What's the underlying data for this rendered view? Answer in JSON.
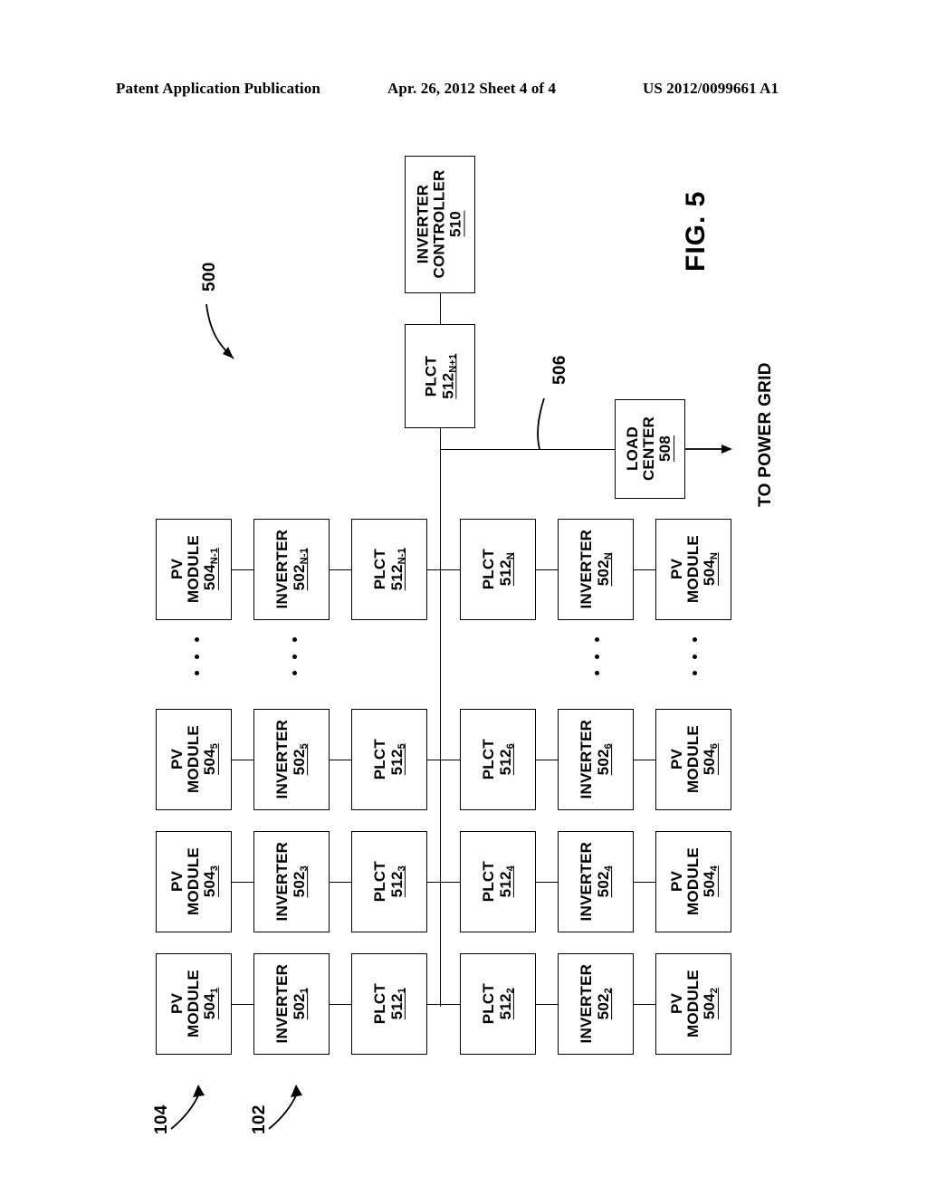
{
  "header": {
    "left": "Patent Application Publication",
    "middle": "Apr. 26, 2012  Sheet 4 of 4",
    "right": "US 2012/0099661 A1"
  },
  "figure": {
    "label": "FIG. 5",
    "system_ref": "500",
    "bus_ref": "506",
    "pv_callout_ref": "104",
    "inverter_callout_ref": "102",
    "grid_label": "TO POWER GRID"
  },
  "blocks": {
    "inverter_controller": {
      "line1": "INVERTER",
      "line2": "CONTROLLER",
      "ref": "510",
      "sub": ""
    },
    "plct_top": {
      "line1": "PLCT",
      "line2": "",
      "ref": "512",
      "sub": "N+1"
    },
    "load_center": {
      "line1": "LOAD",
      "line2": "CENTER",
      "ref": "508",
      "sub": ""
    }
  },
  "rows": [
    {
      "left": [
        {
          "line1": "PV",
          "line2": "MODULE",
          "ref": "504",
          "sub": "N-1"
        },
        {
          "line1": "INVERTER",
          "line2": "",
          "ref": "502",
          "sub": "N-1"
        },
        {
          "line1": "PLCT",
          "line2": "",
          "ref": "512",
          "sub": "N-1"
        }
      ],
      "right": [
        {
          "line1": "PLCT",
          "line2": "",
          "ref": "512",
          "sub": "N"
        },
        {
          "line1": "INVERTER",
          "line2": "",
          "ref": "502",
          "sub": "N"
        },
        {
          "line1": "PV",
          "line2": "MODULE",
          "ref": "504",
          "sub": "N"
        }
      ]
    },
    {
      "left": [
        {
          "line1": "PV",
          "line2": "MODULE",
          "ref": "504",
          "sub": "5"
        },
        {
          "line1": "INVERTER",
          "line2": "",
          "ref": "502",
          "sub": "5"
        },
        {
          "line1": "PLCT",
          "line2": "",
          "ref": "512",
          "sub": "5"
        }
      ],
      "right": [
        {
          "line1": "PLCT",
          "line2": "",
          "ref": "512",
          "sub": "6"
        },
        {
          "line1": "INVERTER",
          "line2": "",
          "ref": "502",
          "sub": "6"
        },
        {
          "line1": "PV",
          "line2": "MODULE",
          "ref": "504",
          "sub": "6"
        }
      ]
    },
    {
      "left": [
        {
          "line1": "PV",
          "line2": "MODULE",
          "ref": "504",
          "sub": "3"
        },
        {
          "line1": "INVERTER",
          "line2": "",
          "ref": "502",
          "sub": "3"
        },
        {
          "line1": "PLCT",
          "line2": "",
          "ref": "512",
          "sub": "3"
        }
      ],
      "right": [
        {
          "line1": "PLCT",
          "line2": "",
          "ref": "512",
          "sub": "4"
        },
        {
          "line1": "INVERTER",
          "line2": "",
          "ref": "502",
          "sub": "4"
        },
        {
          "line1": "PV",
          "line2": "MODULE",
          "ref": "504",
          "sub": "4"
        }
      ]
    },
    {
      "left": [
        {
          "line1": "PV",
          "line2": "MODULE",
          "ref": "504",
          "sub": "1"
        },
        {
          "line1": "INVERTER",
          "line2": "",
          "ref": "502",
          "sub": "1"
        },
        {
          "line1": "PLCT",
          "line2": "",
          "ref": "512",
          "sub": "1"
        }
      ],
      "right": [
        {
          "line1": "PLCT",
          "line2": "",
          "ref": "512",
          "sub": "2"
        },
        {
          "line1": "INVERTER",
          "line2": "",
          "ref": "502",
          "sub": "2"
        },
        {
          "line1": "PV",
          "line2": "MODULE",
          "ref": "504",
          "sub": "2"
        }
      ]
    }
  ]
}
